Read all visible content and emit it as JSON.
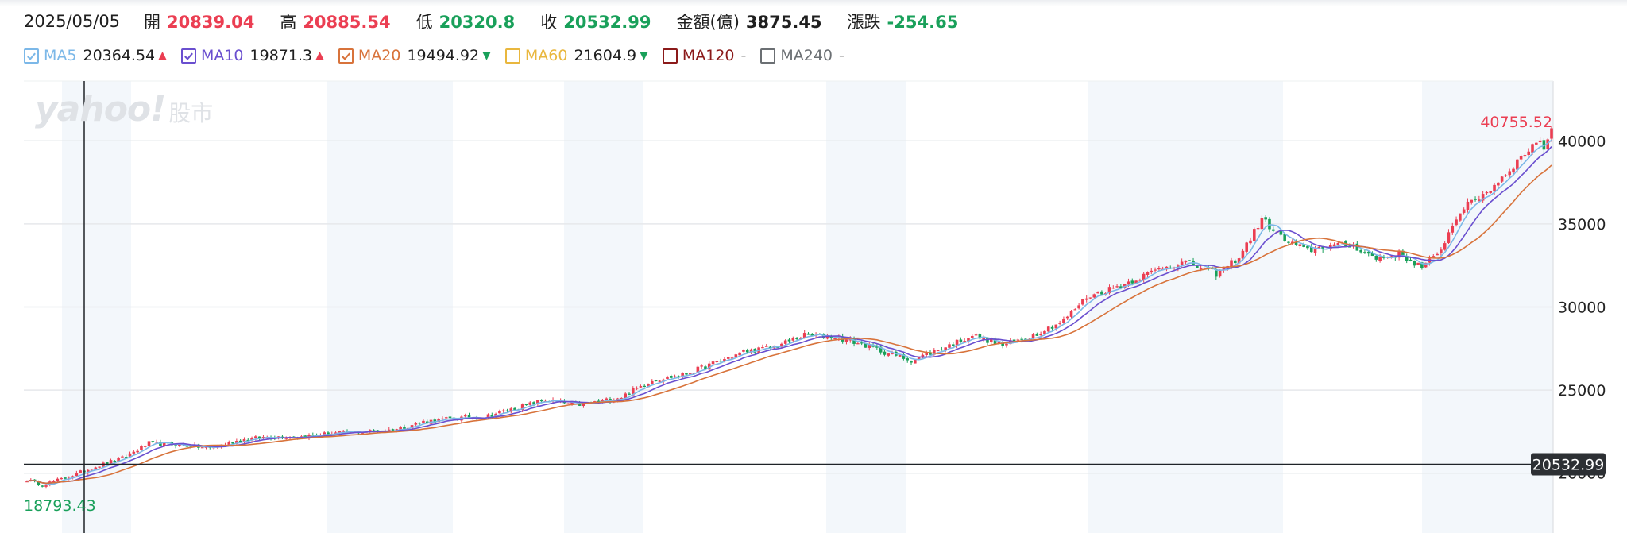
{
  "header": {
    "date": "2025/05/05",
    "open_label": "開",
    "open_value": "20839.04",
    "high_label": "高",
    "high_value": "20885.54",
    "low_label": "低",
    "low_value": "20320.8",
    "close_label": "收",
    "close_value": "20532.99",
    "amount_label": "金額(億)",
    "amount_value": "3875.45",
    "change_label": "漲跌",
    "change_value": "-254.65"
  },
  "legend": [
    {
      "name": "MA5",
      "value": "20364.54",
      "arrow": "▲",
      "dir": "up",
      "color": "#7cb8e8",
      "checked": true
    },
    {
      "name": "MA10",
      "value": "19871.3",
      "arrow": "▲",
      "dir": "up",
      "color": "#6a4fcf",
      "checked": true
    },
    {
      "name": "MA20",
      "value": "19494.92",
      "arrow": "▼",
      "dir": "down",
      "color": "#d8733b",
      "checked": true
    },
    {
      "name": "MA60",
      "value": "21604.9",
      "arrow": "▼",
      "dir": "down",
      "color": "#e9b73e",
      "checked": false
    },
    {
      "name": "MA120",
      "value": "-",
      "arrow": "",
      "dir": "",
      "color": "#8b1a1a",
      "checked": false
    },
    {
      "name": "MA240",
      "value": "-",
      "arrow": "",
      "dir": "",
      "color": "#6b6f73",
      "checked": false
    }
  ],
  "watermark": {
    "brand": "yahoo!",
    "sub": "股市"
  },
  "colors": {
    "up": "#eb3e52",
    "down": "#19a05a",
    "grid": "#e6e8eb",
    "band": "#f3f7fb"
  },
  "chart_data": {
    "type": "candlestick",
    "y_ticks": [
      40000,
      35000,
      30000,
      25000,
      20000
    ],
    "ylim": [
      16400,
      43600
    ],
    "max_label": "40755.52",
    "min_label": "18793.43",
    "last_price_label": "20532.99",
    "last_price": 20532.99,
    "anchors": [
      [
        0,
        19600
      ],
      [
        4,
        19300
      ],
      [
        10,
        19700
      ],
      [
        18,
        20400
      ],
      [
        25,
        20900
      ],
      [
        32,
        21800
      ],
      [
        40,
        21700
      ],
      [
        48,
        21500
      ],
      [
        56,
        22000
      ],
      [
        64,
        22200
      ],
      [
        72,
        22200
      ],
      [
        80,
        22400
      ],
      [
        88,
        22500
      ],
      [
        96,
        22600
      ],
      [
        104,
        23100
      ],
      [
        112,
        23300
      ],
      [
        120,
        23400
      ],
      [
        128,
        23900
      ],
      [
        136,
        24400
      ],
      [
        144,
        24100
      ],
      [
        150,
        24300
      ],
      [
        156,
        24600
      ],
      [
        164,
        25600
      ],
      [
        172,
        25900
      ],
      [
        180,
        26600
      ],
      [
        188,
        27300
      ],
      [
        196,
        27600
      ],
      [
        204,
        28300
      ],
      [
        212,
        28200
      ],
      [
        220,
        27700
      ],
      [
        226,
        27200
      ],
      [
        232,
        26800
      ],
      [
        240,
        27500
      ],
      [
        248,
        28300
      ],
      [
        256,
        27700
      ],
      [
        264,
        28300
      ],
      [
        272,
        29200
      ],
      [
        278,
        30600
      ],
      [
        288,
        31400
      ],
      [
        298,
        32400
      ],
      [
        304,
        32700
      ],
      [
        312,
        32000
      ],
      [
        318,
        33000
      ],
      [
        324,
        35300
      ],
      [
        330,
        34000
      ],
      [
        336,
        33400
      ],
      [
        342,
        33700
      ],
      [
        348,
        33700
      ],
      [
        354,
        32900
      ],
      [
        360,
        33200
      ],
      [
        366,
        32400
      ],
      [
        370,
        33100
      ],
      [
        376,
        35800
      ],
      [
        384,
        37100
      ],
      [
        392,
        39000
      ],
      [
        396,
        40000
      ],
      [
        398,
        39600
      ],
      [
        400,
        40700
      ]
    ]
  }
}
